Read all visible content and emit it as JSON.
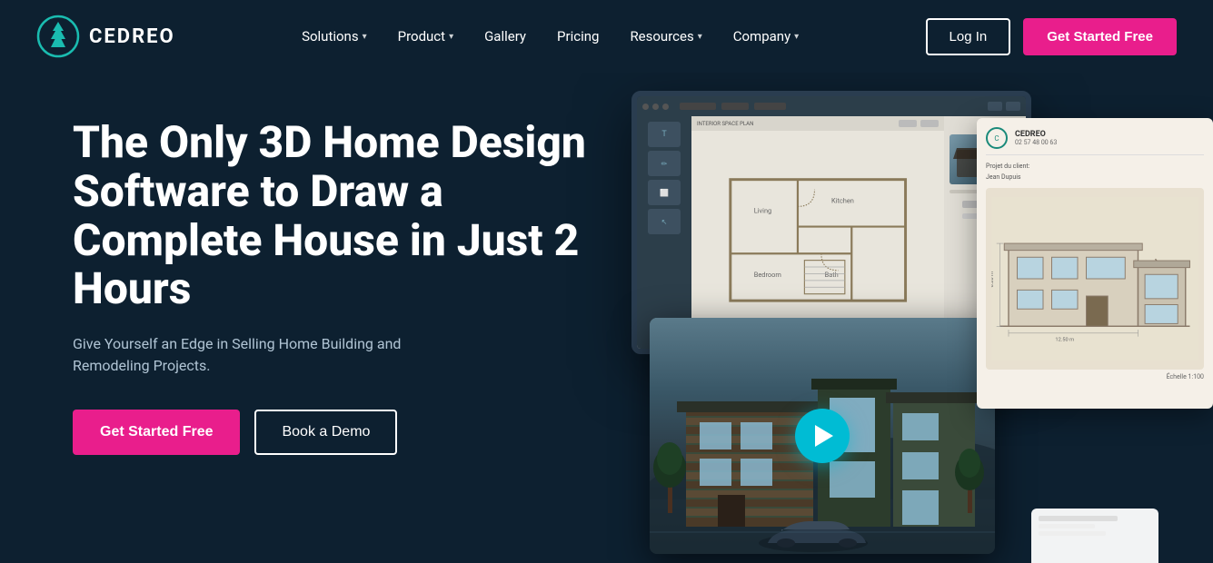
{
  "brand": {
    "name": "CEDREO",
    "logo_alt": "Cedreo logo"
  },
  "nav": {
    "items": [
      {
        "label": "Solutions",
        "has_dropdown": true
      },
      {
        "label": "Product",
        "has_dropdown": true
      },
      {
        "label": "Gallery",
        "has_dropdown": false
      },
      {
        "label": "Pricing",
        "has_dropdown": false
      },
      {
        "label": "Resources",
        "has_dropdown": true
      },
      {
        "label": "Company",
        "has_dropdown": true
      }
    ],
    "login_label": "Log In",
    "cta_label": "Get Started Free"
  },
  "hero": {
    "title": "The Only 3D Home Design Software to Draw a Complete House in Just 2 Hours",
    "subtitle": "Give Yourself an Edge in Selling Home Building and Remodeling Projects.",
    "cta_primary": "Get Started Free",
    "cta_secondary": "Book a Demo"
  },
  "colors": {
    "bg": "#0d2030",
    "accent_pink": "#e91e8c",
    "accent_teal": "#00bcd4",
    "text_muted": "#b0c4d4"
  }
}
